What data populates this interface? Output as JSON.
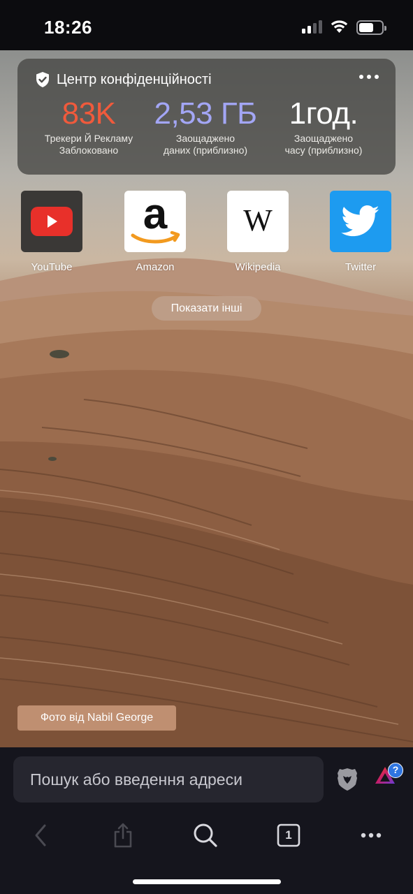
{
  "status_bar": {
    "time": "18:26",
    "battery_level": 0.55
  },
  "privacy_hub": {
    "title": "Центр конфіденційності",
    "stats": [
      {
        "value": "83K",
        "label_line1": "Трекери Й Рекламу",
        "label_line2": "Заблоковано",
        "color": "#f05a3c"
      },
      {
        "value": "2,53 ГБ",
        "label_line1": "Заощаджено",
        "label_line2": "даних (приблизно)",
        "color": "#a3a6f5"
      },
      {
        "value": "1год.",
        "label_line1": "Заощаджено",
        "label_line2": "часу (приблизно)",
        "color": "#ffffff"
      }
    ]
  },
  "favorites": [
    {
      "name": "YouTube",
      "icon": "youtube-icon"
    },
    {
      "name": "Amazon",
      "icon": "amazon-icon"
    },
    {
      "name": "Wikipedia",
      "icon": "wikipedia-icon"
    },
    {
      "name": "Twitter",
      "icon": "twitter-icon"
    }
  ],
  "show_more_label": "Показати інші",
  "photo_credit": "Фото від Nabil George",
  "search": {
    "placeholder": "Пошук або введення адреси"
  },
  "rewards_badge": "?",
  "tabs_count": "1",
  "colors": {
    "bottom_bar": "#15151d",
    "search_field": "#26262f",
    "accent_blue": "#2f75e0"
  }
}
